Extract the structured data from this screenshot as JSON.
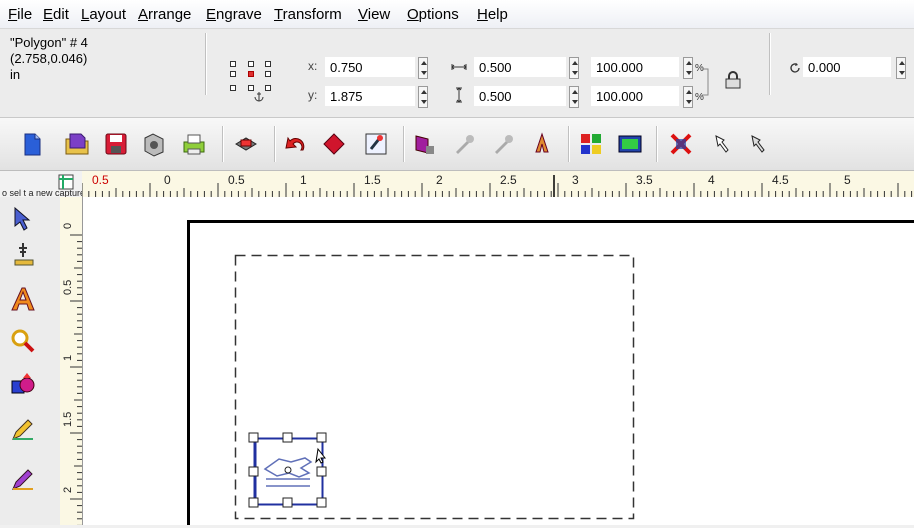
{
  "menu": {
    "items": [
      "File",
      "Edit",
      "Layout",
      "Arrange",
      "Engrave",
      "Transform",
      "View",
      "Options",
      "Help"
    ]
  },
  "propbar": {
    "object_name": "\"Polygon\" # 4",
    "object_coords": "(2.758,0.046)",
    "units": "in",
    "x_label": "x:",
    "x_value": "0.750",
    "y_label": "y:",
    "y_value": "1.875",
    "width_value": "0.500",
    "height_value": "0.500",
    "scale_x": "100.000",
    "scale_y": "100.000",
    "percent": "%",
    "rotation_value": "0.000"
  },
  "toolbar": {
    "buttons": [
      "new-icon",
      "open-icon",
      "save-icon",
      "import-icon",
      "print-icon",
      "engrave-icon",
      "undo-icon",
      "redo-icon",
      "zoom-icon",
      "arrange-icon",
      "align-icon",
      "distribute-icon",
      "mirror-icon",
      "group-icon",
      "ungroup-icon",
      "delete-icon",
      "node-edit-icon",
      "pen-icon"
    ]
  },
  "rulers": {
    "h_labels": [
      "0.5",
      "0",
      "0.5",
      "1",
      "1.5",
      "2",
      "2.5",
      "3",
      "3.5",
      "4",
      "4.5",
      "5"
    ],
    "v_labels": [
      "0",
      "0.5",
      "1",
      "1.5",
      "2"
    ]
  },
  "canvas": {
    "hint_text": "o sel t a new capture area"
  },
  "colors": {
    "selection": "#2030a0",
    "ruler_bg": "#fbf8e4",
    "page_border": "#000000"
  }
}
